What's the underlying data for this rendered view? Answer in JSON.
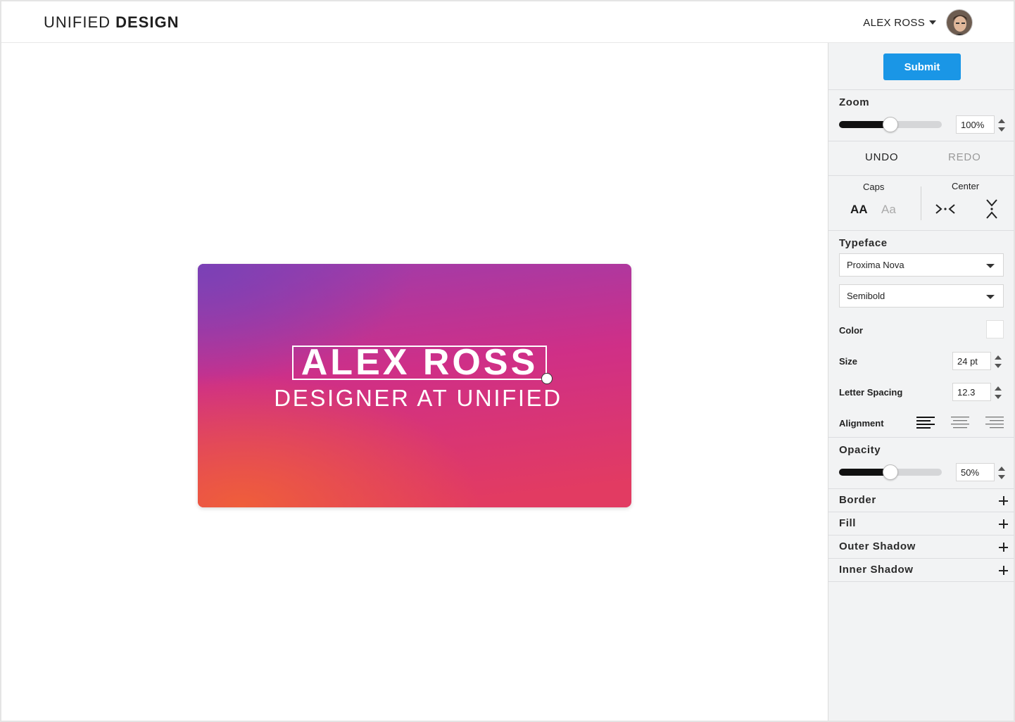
{
  "header": {
    "brand_light": "UNIFIED",
    "brand_bold": "DESIGN",
    "user_name": "ALEX ROSS"
  },
  "card": {
    "name": "ALEX ROSS",
    "subtitle": "DESIGNER AT UNIFIED",
    "gradient": [
      "#7b3fb6",
      "#d8307e",
      "#ee5a3f"
    ]
  },
  "sidebar": {
    "submit_label": "Submit",
    "zoom": {
      "title": "Zoom",
      "value_label": "100%",
      "level": 0.5
    },
    "history": {
      "undo": "UNDO",
      "redo": "REDO"
    },
    "caps": {
      "title": "Caps",
      "upper": "AA",
      "mixed": "Aa"
    },
    "center": {
      "title": "Center"
    },
    "typeface": {
      "title": "Typeface",
      "family": "Proxima Nova",
      "weight": "Semibold",
      "color_label": "Color",
      "color_value": "#ffffff",
      "size_label": "Size",
      "size_value": "24 pt",
      "spacing_label": "Letter Spacing",
      "spacing_value": "12.3",
      "alignment_label": "Alignment",
      "alignment_selected": "left"
    },
    "opacity": {
      "title": "Opacity",
      "value_label": "50%",
      "level": 0.5
    },
    "panels": [
      "Border",
      "Fill",
      "Outer Shadow",
      "Inner Shadow"
    ]
  },
  "colors": {
    "accent": "#1a96e6",
    "sidebar_bg": "#f2f3f4"
  }
}
